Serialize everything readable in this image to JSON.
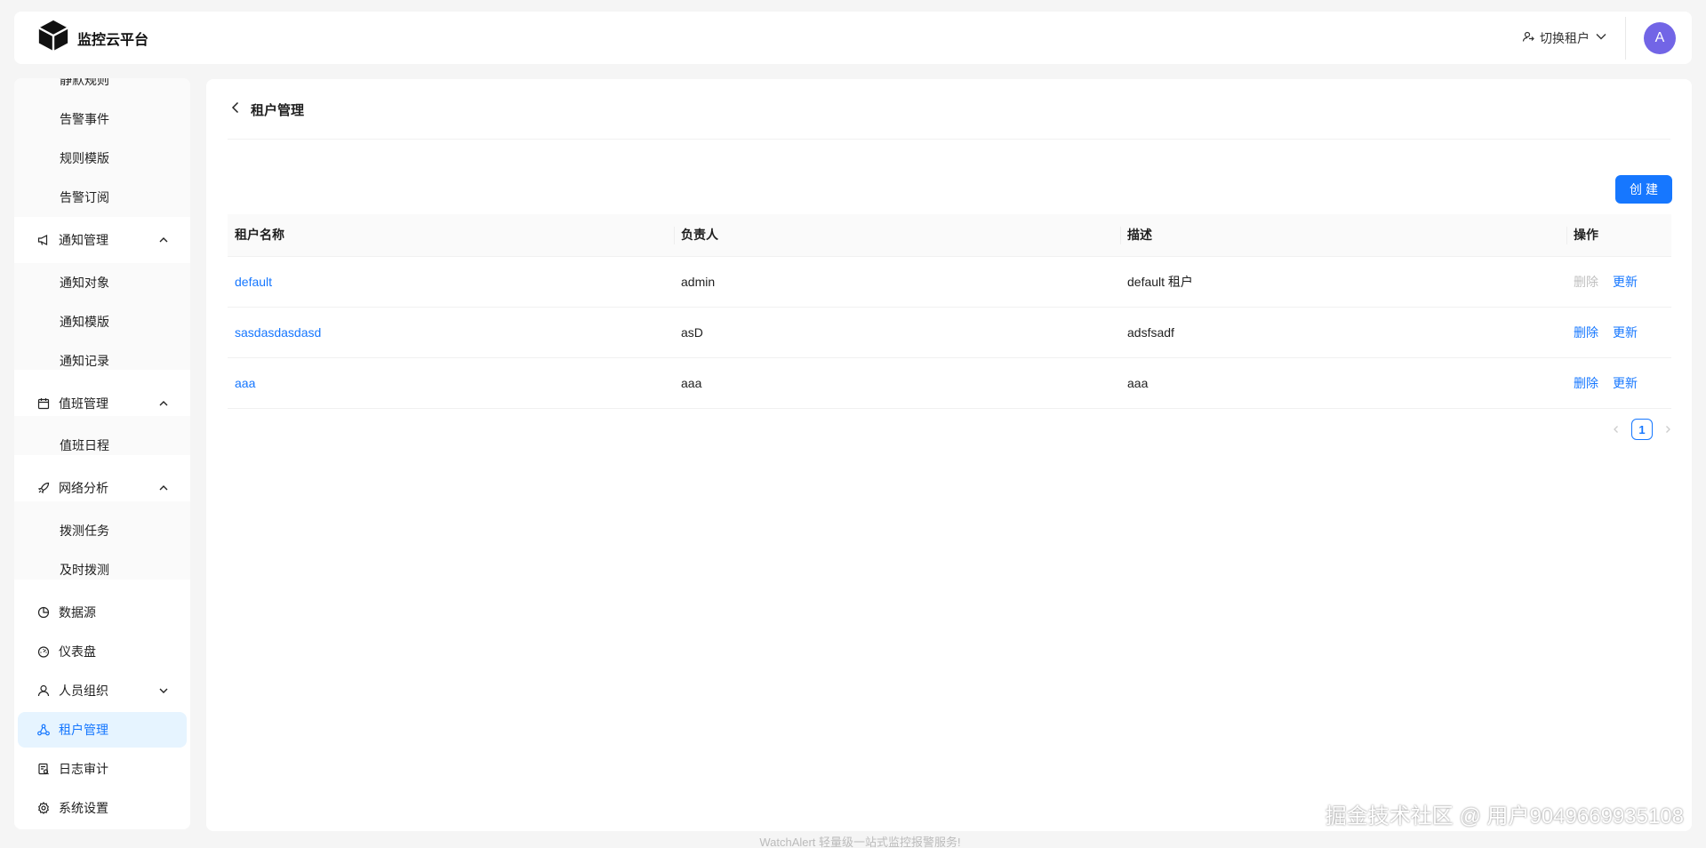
{
  "header": {
    "logo_text": "监控云平台",
    "tenant_switch_label": "切换租户",
    "avatar_letter": "A"
  },
  "sidebar": {
    "items": [
      {
        "label": "静默规则",
        "icon": "",
        "level": "sub"
      },
      {
        "label": "告警事件",
        "icon": "",
        "level": "sub"
      },
      {
        "label": "规则模版",
        "icon": "",
        "level": "sub"
      },
      {
        "label": "告警订阅",
        "icon": "",
        "level": "sub"
      },
      {
        "label": "通知管理",
        "icon": "megaphone-icon",
        "level": "top",
        "expanded": true
      },
      {
        "label": "通知对象",
        "icon": "",
        "level": "sub"
      },
      {
        "label": "通知模版",
        "icon": "",
        "level": "sub"
      },
      {
        "label": "通知记录",
        "icon": "",
        "level": "sub"
      },
      {
        "label": "值班管理",
        "icon": "calendar-icon",
        "level": "top",
        "expanded": true
      },
      {
        "label": "值班日程",
        "icon": "",
        "level": "sub"
      },
      {
        "label": "网络分析",
        "icon": "rocket-icon",
        "level": "top",
        "expanded": true
      },
      {
        "label": "拨测任务",
        "icon": "",
        "level": "sub"
      },
      {
        "label": "及时拨测",
        "icon": "",
        "level": "sub"
      },
      {
        "label": "数据源",
        "icon": "pie-chart-icon",
        "level": "top"
      },
      {
        "label": "仪表盘",
        "icon": "dashboard-icon",
        "level": "top"
      },
      {
        "label": "人员组织",
        "icon": "user-icon",
        "level": "top",
        "expanded": false
      },
      {
        "label": "租户管理",
        "icon": "cluster-icon",
        "level": "top",
        "active": true
      },
      {
        "label": "日志审计",
        "icon": "audit-icon",
        "level": "top"
      },
      {
        "label": "系统设置",
        "icon": "setting-icon",
        "level": "top"
      }
    ]
  },
  "main": {
    "title": "租户管理",
    "create_label": "创建",
    "table": {
      "columns": [
        "租户名称",
        "负责人",
        "描述",
        "操作"
      ],
      "rows": [
        {
          "name": "default",
          "owner": "admin",
          "desc": "default 租户",
          "delete": "删除",
          "update": "更新",
          "delete_disabled": true
        },
        {
          "name": "sasdasdasdasd",
          "owner": "asD",
          "desc": "adsfsadf",
          "delete": "删除",
          "update": "更新",
          "delete_disabled": false
        },
        {
          "name": "aaa",
          "owner": "aaa",
          "desc": "aaa",
          "delete": "删除",
          "update": "更新",
          "delete_disabled": false
        }
      ]
    },
    "pagination": {
      "current_page": "1"
    }
  },
  "footer": {
    "text": "WatchAlert 轻量级一站式监控报警服务!"
  },
  "watermark": {
    "text": "掘金技术社区 @ 用户9049669935108"
  },
  "colors": {
    "accent": "#1677ff",
    "avatar": "#7265e6",
    "active_bg": "#e6f4ff"
  }
}
